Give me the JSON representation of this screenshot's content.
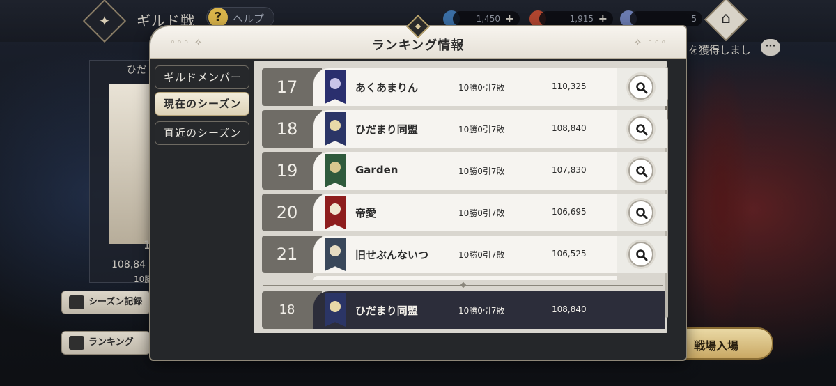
{
  "topbar": {
    "title": "ギルド戦",
    "help_label": "ヘルプ",
    "resources": [
      {
        "name": "blue-gem-icon",
        "value": "1,450",
        "color": "#3a6ea5"
      },
      {
        "name": "red-orb-icon",
        "value": "1,915",
        "color": "#b0452f"
      },
      {
        "name": "sword-icon",
        "value": "5",
        "color": "#6a7bb0"
      }
    ]
  },
  "background": {
    "obtain_text": "を獲得しまし",
    "left_banner_text": "ひだ",
    "left_rank": "1",
    "left_score": "108,84",
    "left_record": "10勝",
    "season_record_button": "シーズン記録",
    "ranking_button": "ランキング",
    "battle_button": "戦場入場"
  },
  "modal": {
    "title": "ランキング情報",
    "tabs": [
      {
        "label": "ギルドメンバー",
        "active": false
      },
      {
        "label": "現在のシーズン",
        "active": true
      },
      {
        "label": "直近のシーズン",
        "active": false
      }
    ]
  },
  "rankings": [
    {
      "rank": "17",
      "name": "あくあまりん",
      "record": "10勝0引7敗",
      "score": "110,325",
      "flag_color": "#2a2f6e",
      "mark_color": "#c9c4e8"
    },
    {
      "rank": "18",
      "name": "ひだまり同盟",
      "record": "10勝0引7敗",
      "score": "108,840",
      "flag_color": "#2b3566",
      "mark_color": "#e8d9a8"
    },
    {
      "rank": "19",
      "name": "Garden",
      "record": "10勝0引7敗",
      "score": "107,830",
      "flag_color": "#2f5a3c",
      "mark_color": "#d8c88f"
    },
    {
      "rank": "20",
      "name": "帝愛",
      "record": "10勝0引7敗",
      "score": "106,695",
      "flag_color": "#8e1d1d",
      "mark_color": "#f0e6d0"
    },
    {
      "rank": "21",
      "name": "旧せぶんないつ",
      "record": "10勝0引7敗",
      "score": "106,525",
      "flag_color": "#39475a",
      "mark_color": "#e6dcc2"
    }
  ],
  "my_guild": {
    "rank": "18",
    "name": "ひだまり同盟",
    "record": "10勝0引7敗",
    "score": "108,840",
    "flag_color": "#2b3566",
    "mark_color": "#e8d9a8"
  }
}
